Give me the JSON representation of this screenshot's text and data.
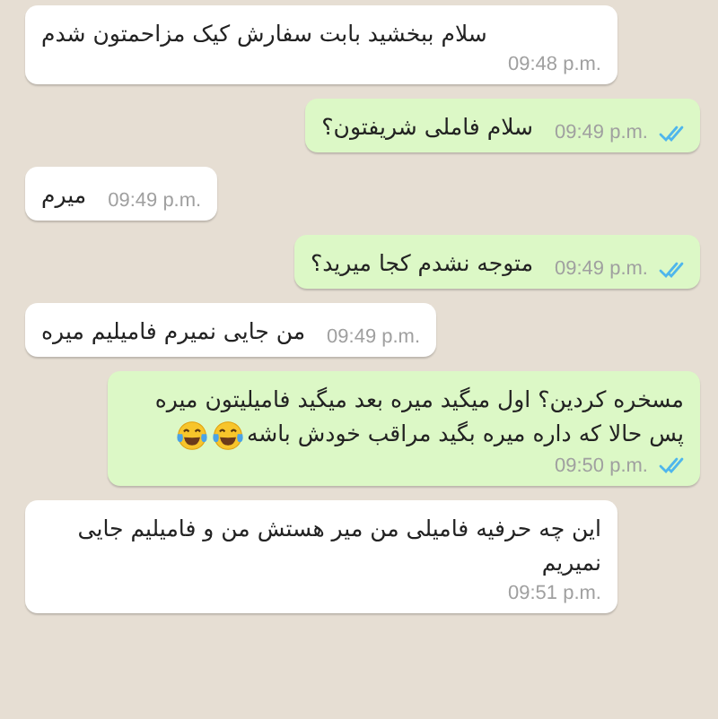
{
  "messages": [
    {
      "kind": "incoming",
      "text": "سلام ببخشید بابت سفارش کیک مزاحمتون شدم",
      "time": "09:48 p.m."
    },
    {
      "kind": "outgoing",
      "text": "سلام فاملی شریفتون؟",
      "time": "09:49 p.m.",
      "read": true
    },
    {
      "kind": "incoming",
      "text": "میرم",
      "time": "09:49 p.m."
    },
    {
      "kind": "outgoing",
      "text": "متوجه نشدم کجا میرید؟",
      "time": "09:49 p.m.",
      "read": true
    },
    {
      "kind": "incoming",
      "text": "من جایی نمیرم فامیلیم میره",
      "time": "09:49 p.m."
    },
    {
      "kind": "outgoing",
      "text": "مسخره کردین؟  اول میگید میره بعد میگید فامیلیتون میره پس حالا  که داره میره بگید مراقب خودش باشه",
      "emojis": [
        {
          "kind": "tears-of-joy"
        },
        {
          "kind": "tears-of-joy"
        }
      ],
      "time": "09:50 p.m.",
      "read": true
    },
    {
      "kind": "incoming",
      "text": "این چه حرفیه فامیلی من میر هستش من و فامیلیم جایی نمیریم",
      "time": "09:51 p.m."
    }
  ]
}
